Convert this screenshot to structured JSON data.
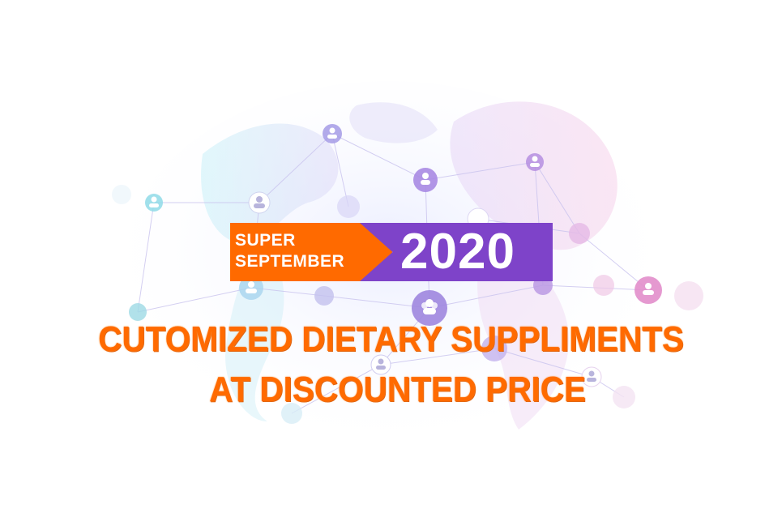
{
  "badge": {
    "line1": "SUPER",
    "line2": "SEPTEMBER",
    "year": "2020",
    "colors": {
      "orange": "#ff6a00",
      "purple": "#7e43c9"
    }
  },
  "headline": {
    "line1": "CUTOMIZED DIETARY SUPPLIMENTS",
    "line2": "AT DISCOUNTED PRICE",
    "color": "#ff6a00"
  },
  "background": {
    "description_icon": "globe-network-icon",
    "node_icon": "user-group-icon"
  }
}
